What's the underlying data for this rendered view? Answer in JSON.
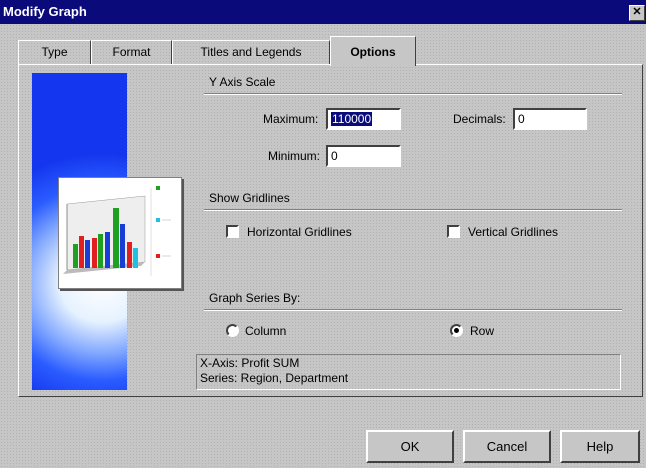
{
  "window": {
    "title": "Modify Graph",
    "close_glyph": "✕"
  },
  "tabs": [
    {
      "label": "Type"
    },
    {
      "label": "Format"
    },
    {
      "label": "Titles and Legends"
    },
    {
      "label": "Options"
    }
  ],
  "active_tab": "Options",
  "y_axis": {
    "heading": "Y Axis Scale",
    "maximum_label": "Maximum:",
    "maximum_value": "110000",
    "minimum_label": "Minimum:",
    "minimum_value": "0",
    "decimals_label": "Decimals:",
    "decimals_value": "0"
  },
  "gridlines": {
    "heading": "Show Gridlines",
    "horizontal_label": "Horizontal Gridlines",
    "horizontal_checked": false,
    "vertical_label": "Vertical Gridlines",
    "vertical_checked": false
  },
  "series_by": {
    "heading": "Graph Series By:",
    "column_label": "Column",
    "row_label": "Row",
    "selected": "Row"
  },
  "info": {
    "line1": "X-Axis: Profit SUM",
    "line2": "Series: Region, Department"
  },
  "buttons": {
    "ok": "OK",
    "cancel": "Cancel",
    "help": "Help"
  },
  "colors": {
    "titlebar": "#0a0a7a",
    "selection": "#0a0a7a",
    "panel_blue": "#1436ee"
  },
  "preview_icon": "bar-chart-thumbnail"
}
